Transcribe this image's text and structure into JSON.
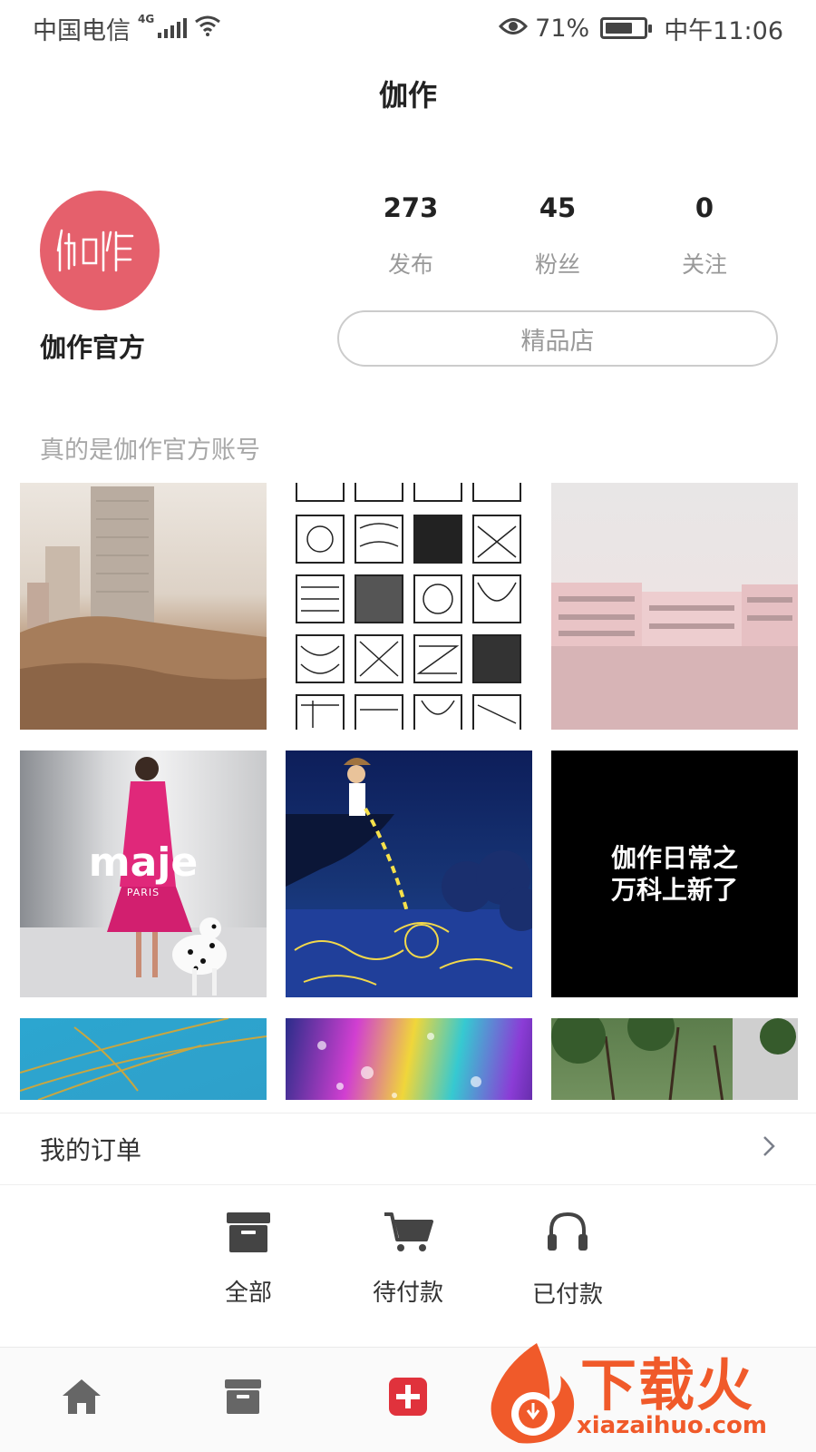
{
  "status_bar": {
    "carrier": "中国电信",
    "network": "4G",
    "battery_percent": "71%",
    "battery_level": 0.71,
    "time": "中午11:06",
    "icons": [
      "signal-icon",
      "wifi-icon",
      "eye-icon",
      "battery-icon"
    ]
  },
  "header": {
    "title": "伽作"
  },
  "profile": {
    "name": "伽作官方",
    "avatar_color": "#e5606c",
    "stats": [
      {
        "value": "273",
        "label": "发布"
      },
      {
        "value": "45",
        "label": "粉丝"
      },
      {
        "value": "0",
        "label": "关注"
      }
    ],
    "shop_button": "精品店",
    "bio": "真的是伽作官方账号"
  },
  "grid": {
    "tiles": [
      {
        "name": "photo-city-rocks"
      },
      {
        "name": "photo-pattern-grid"
      },
      {
        "name": "photo-pink-buildings"
      },
      {
        "name": "photo-maje-fashion",
        "text": "maje",
        "subtext": "PARIS"
      },
      {
        "name": "photo-starry-illustration"
      },
      {
        "name": "photo-daily-text",
        "text": "伽作日常之\n万科上新了"
      },
      {
        "name": "photo-grass-sky"
      },
      {
        "name": "photo-iridescent"
      },
      {
        "name": "photo-trees"
      }
    ]
  },
  "orders": {
    "title": "我的订单",
    "actions": [
      {
        "label": "全部",
        "icon": "box-icon"
      },
      {
        "label": "待付款",
        "icon": "cart-icon"
      },
      {
        "label": "已付款",
        "icon": "headset-icon"
      }
    ]
  },
  "bottom_nav": {
    "items": [
      {
        "icon": "home-icon"
      },
      {
        "icon": "box-icon"
      },
      {
        "icon": "plus-icon",
        "color": "#e0323c"
      }
    ]
  },
  "watermark": {
    "brand": "下载火",
    "url": "xiazaihuo.com",
    "color": "#f05a2a"
  }
}
